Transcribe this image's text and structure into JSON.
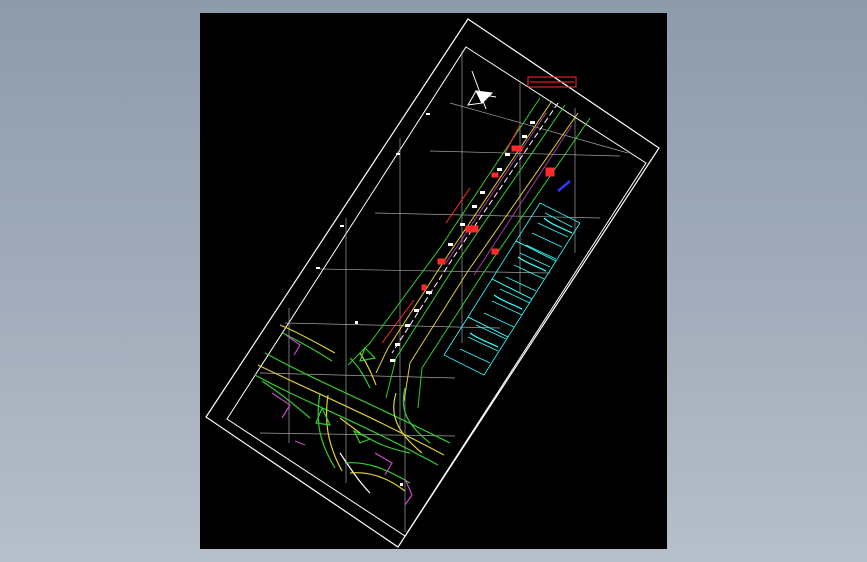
{
  "colors": {
    "background": "#000000",
    "sheet_border": "#ffffff",
    "grid": "#bfbfbf",
    "road_green": "#33cc33",
    "road_yellow": "#e0d030",
    "centerline_white": "#ffffff",
    "annotation_red": "#ff2a2a",
    "profile_cyan": "#33ffff",
    "note_magenta": "#cc44cc",
    "mark_blue": "#2a3cff"
  },
  "icons": {
    "north_arrow": "north-arrow-icon"
  }
}
